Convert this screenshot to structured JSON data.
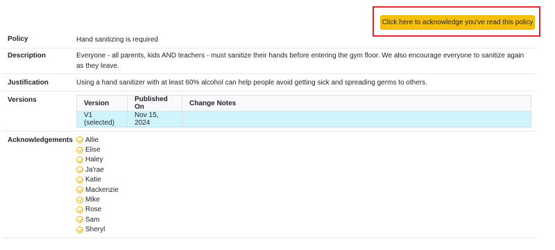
{
  "acknowledge_button": {
    "label": "Click here to acknowledge you've read this policy"
  },
  "policy": {
    "label": "Policy",
    "value": "Hand sanitizing is required"
  },
  "description": {
    "label": "Description",
    "value": "Everyone - all parents, kids AND teachers - must sanitize their hands before entering the gym floor. We also encourage everyone to sanitize again as they leave."
  },
  "justification": {
    "label": "Justification",
    "value": "Using a hand sanitizer with at least 60% alcohol can help people avoid getting sick and spreading germs to others."
  },
  "versions": {
    "label": "Versions",
    "columns": [
      "Version",
      "Published On",
      "Change Notes"
    ],
    "rows": [
      {
        "version": "V1 (selected)",
        "published_on": "Nov 15, 2024",
        "change_notes": ""
      }
    ],
    "selected_row_color": "#cff4fc"
  },
  "acknowledgements": {
    "label": "Acknowledgements",
    "icon": "check-circle-icon",
    "icon_color": "#f0b400",
    "names": [
      "Allie",
      "Elise",
      "Haley",
      "Ja'rae",
      "Katie",
      "Mackenzie",
      "Mike",
      "Rose",
      "Sam",
      "Sheryl"
    ]
  },
  "colors": {
    "highlight_border": "#d9262b",
    "button_bg": "#f7c009"
  }
}
